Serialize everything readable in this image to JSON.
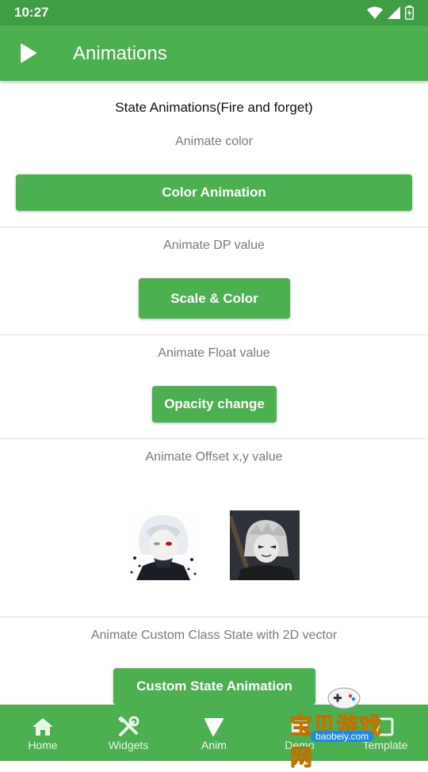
{
  "status_bar": {
    "time": "10:27"
  },
  "app_bar": {
    "title": "Animations",
    "icon": "play-icon"
  },
  "content": {
    "heading": "State Animations(Fire and forget)",
    "sections": [
      {
        "label": "Animate color",
        "button": "Color Animation"
      },
      {
        "label": "Animate DP value",
        "button": "Scale & Color"
      },
      {
        "label": "Animate Float value",
        "button": "Opacity change"
      },
      {
        "label": "Animate Offset x,y value"
      },
      {
        "label": "Animate Custom Class State with 2D vector",
        "button": "Custom State Animation"
      }
    ]
  },
  "bottom_nav": {
    "items": [
      {
        "label": "Home",
        "icon": "home-icon"
      },
      {
        "label": "Widgets",
        "icon": "tools-icon"
      },
      {
        "label": "Anim",
        "icon": "anim-icon"
      },
      {
        "label": "Demo",
        "icon": "demo-icon"
      },
      {
        "label": "Template",
        "icon": "template-icon"
      }
    ]
  },
  "watermark": {
    "text": "宝贝游戏网",
    "site": "baobeiy.com"
  },
  "colors": {
    "primary": "#4caf50",
    "status_bar": "#3f9e43",
    "label_gray": "#7a7a7a"
  }
}
